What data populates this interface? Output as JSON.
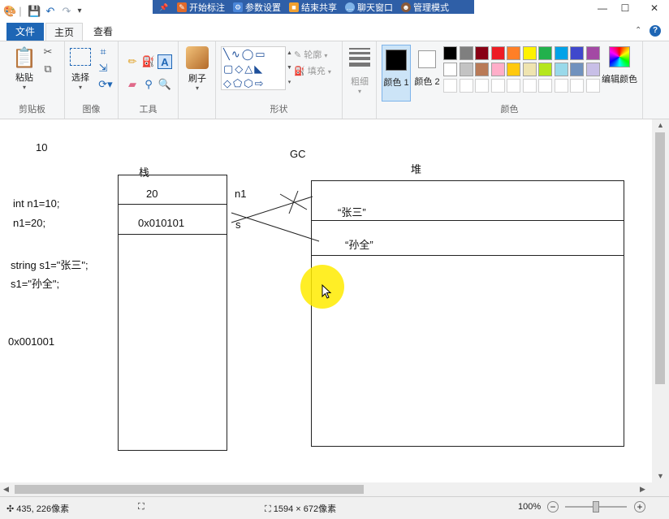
{
  "meeting_bar": {
    "items": [
      {
        "label": "开始标注"
      },
      {
        "label": "参数设置"
      },
      {
        "label": "结束共享"
      },
      {
        "label": "聊天窗口"
      },
      {
        "label": "管理模式"
      }
    ]
  },
  "tabs": {
    "file": "文件",
    "home": "主页",
    "view": "查看"
  },
  "ribbon": {
    "clipboard": {
      "paste": "粘贴",
      "group": "剪贴板"
    },
    "image": {
      "select": "选择",
      "group": "图像"
    },
    "tools": {
      "group": "工具"
    },
    "brushes": {
      "label": "刷子"
    },
    "shapes": {
      "outline": "轮廓",
      "fill": "填充",
      "group": "形状"
    },
    "size": {
      "label": "粗细"
    },
    "colors": {
      "color1": "颜色 1",
      "color2": "颜色 2",
      "edit": "编辑颜色",
      "group": "颜色",
      "palette_row1": [
        "#000000",
        "#7f7f7f",
        "#880015",
        "#ed1c24",
        "#ff7f27",
        "#fff200",
        "#22b14c",
        "#00a2e8",
        "#3f48cc",
        "#a349a4"
      ],
      "palette_row2": [
        "#ffffff",
        "#c3c3c3",
        "#b97a57",
        "#ffaec9",
        "#ffc90e",
        "#efe4b0",
        "#b5e61d",
        "#99d9ea",
        "#7092be",
        "#c8bfe7"
      ]
    }
  },
  "canvas": {
    "texts": {
      "ten": "10",
      "gc": "GC",
      "stack": "栈",
      "heap": "堆",
      "int_decl": "int n1=10;",
      "n1_assign": "n1=20;",
      "string_decl": "string s1=\"张三\";",
      "s1_assign": "s1=\"孙全\";",
      "addr_free": "0x001001",
      "stack_val": "20",
      "stack_addr": "0x010101",
      "n1_label": "n1",
      "s_label": "s",
      "heap_zhangsan": "“张三”",
      "heap_sunquan": "“孙全”"
    }
  },
  "status": {
    "cursor_pos": "435, 226像素",
    "canvas_size": "1594 × 672像素",
    "zoom": "100%"
  }
}
